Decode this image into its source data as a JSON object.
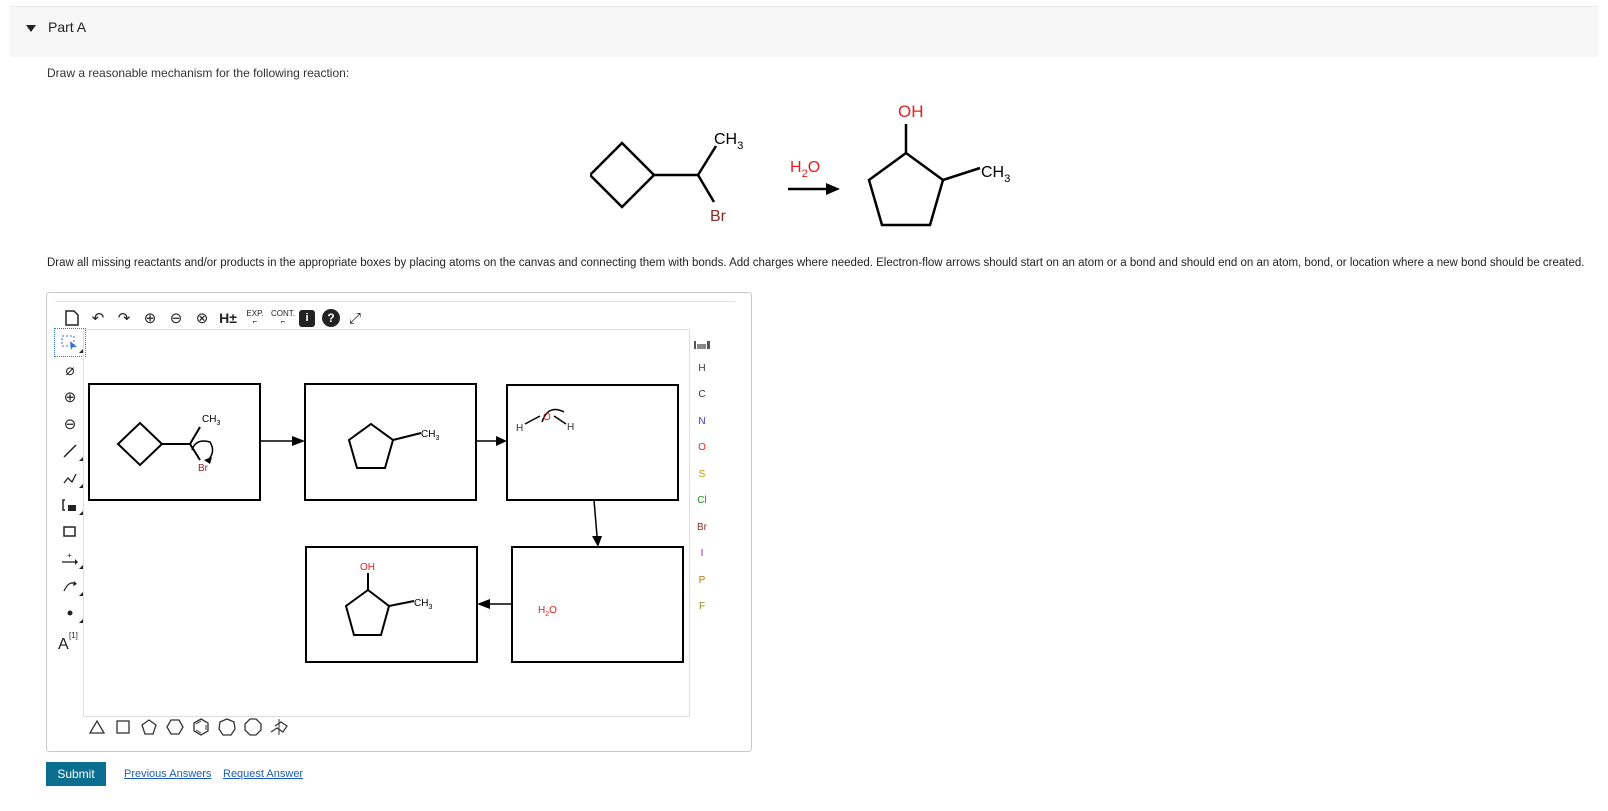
{
  "part": {
    "title": "Part A"
  },
  "question": {
    "prompt": "Draw a reasonable mechanism for the following reaction:",
    "instructions": "Draw all missing reactants and/or products in the appropriate boxes by placing atoms on the canvas and connecting them with bonds. Add charges where needed. Electron-flow arrows should start on an atom or a bond and should end on an atom, bond, or location where a new bond should be created."
  },
  "reaction": {
    "reactant_ch3": "CH3",
    "reactant_br": "Br",
    "reagent": "H2O",
    "product_oh": "OH",
    "product_ch3": "CH3"
  },
  "toolbar": {
    "exp_label": "EXP.",
    "cont_label": "CONT.",
    "h_label": "H±"
  },
  "lefttools": {
    "charge_label": "[1]"
  },
  "periodic": [
    "H",
    "C",
    "N",
    "O",
    "S",
    "Cl",
    "Br",
    "I",
    "P",
    "F"
  ],
  "element_colors": {
    "H": "#333333",
    "C": "#333333",
    "N": "#3333cc",
    "O": "#e02020",
    "S": "#b59a00",
    "Cl": "#1a8a1a",
    "Br": "#8a2a2a",
    "I": "#7a2a9a",
    "P": "#c07000",
    "F": "#8a8a20"
  },
  "canvas": {
    "box1_ch3": "CH3",
    "box1_br": "Br",
    "box2_ch3": "CH3",
    "box3_h_left": "H",
    "box3_o": "O",
    "box3_h_right": "H",
    "box4_oh": "OH",
    "box4_ch3": "CH3",
    "box5_water": "H2O"
  },
  "actions": {
    "submit": "Submit",
    "previous_answers": "Previous Answers",
    "request_answer": "Request Answer"
  }
}
